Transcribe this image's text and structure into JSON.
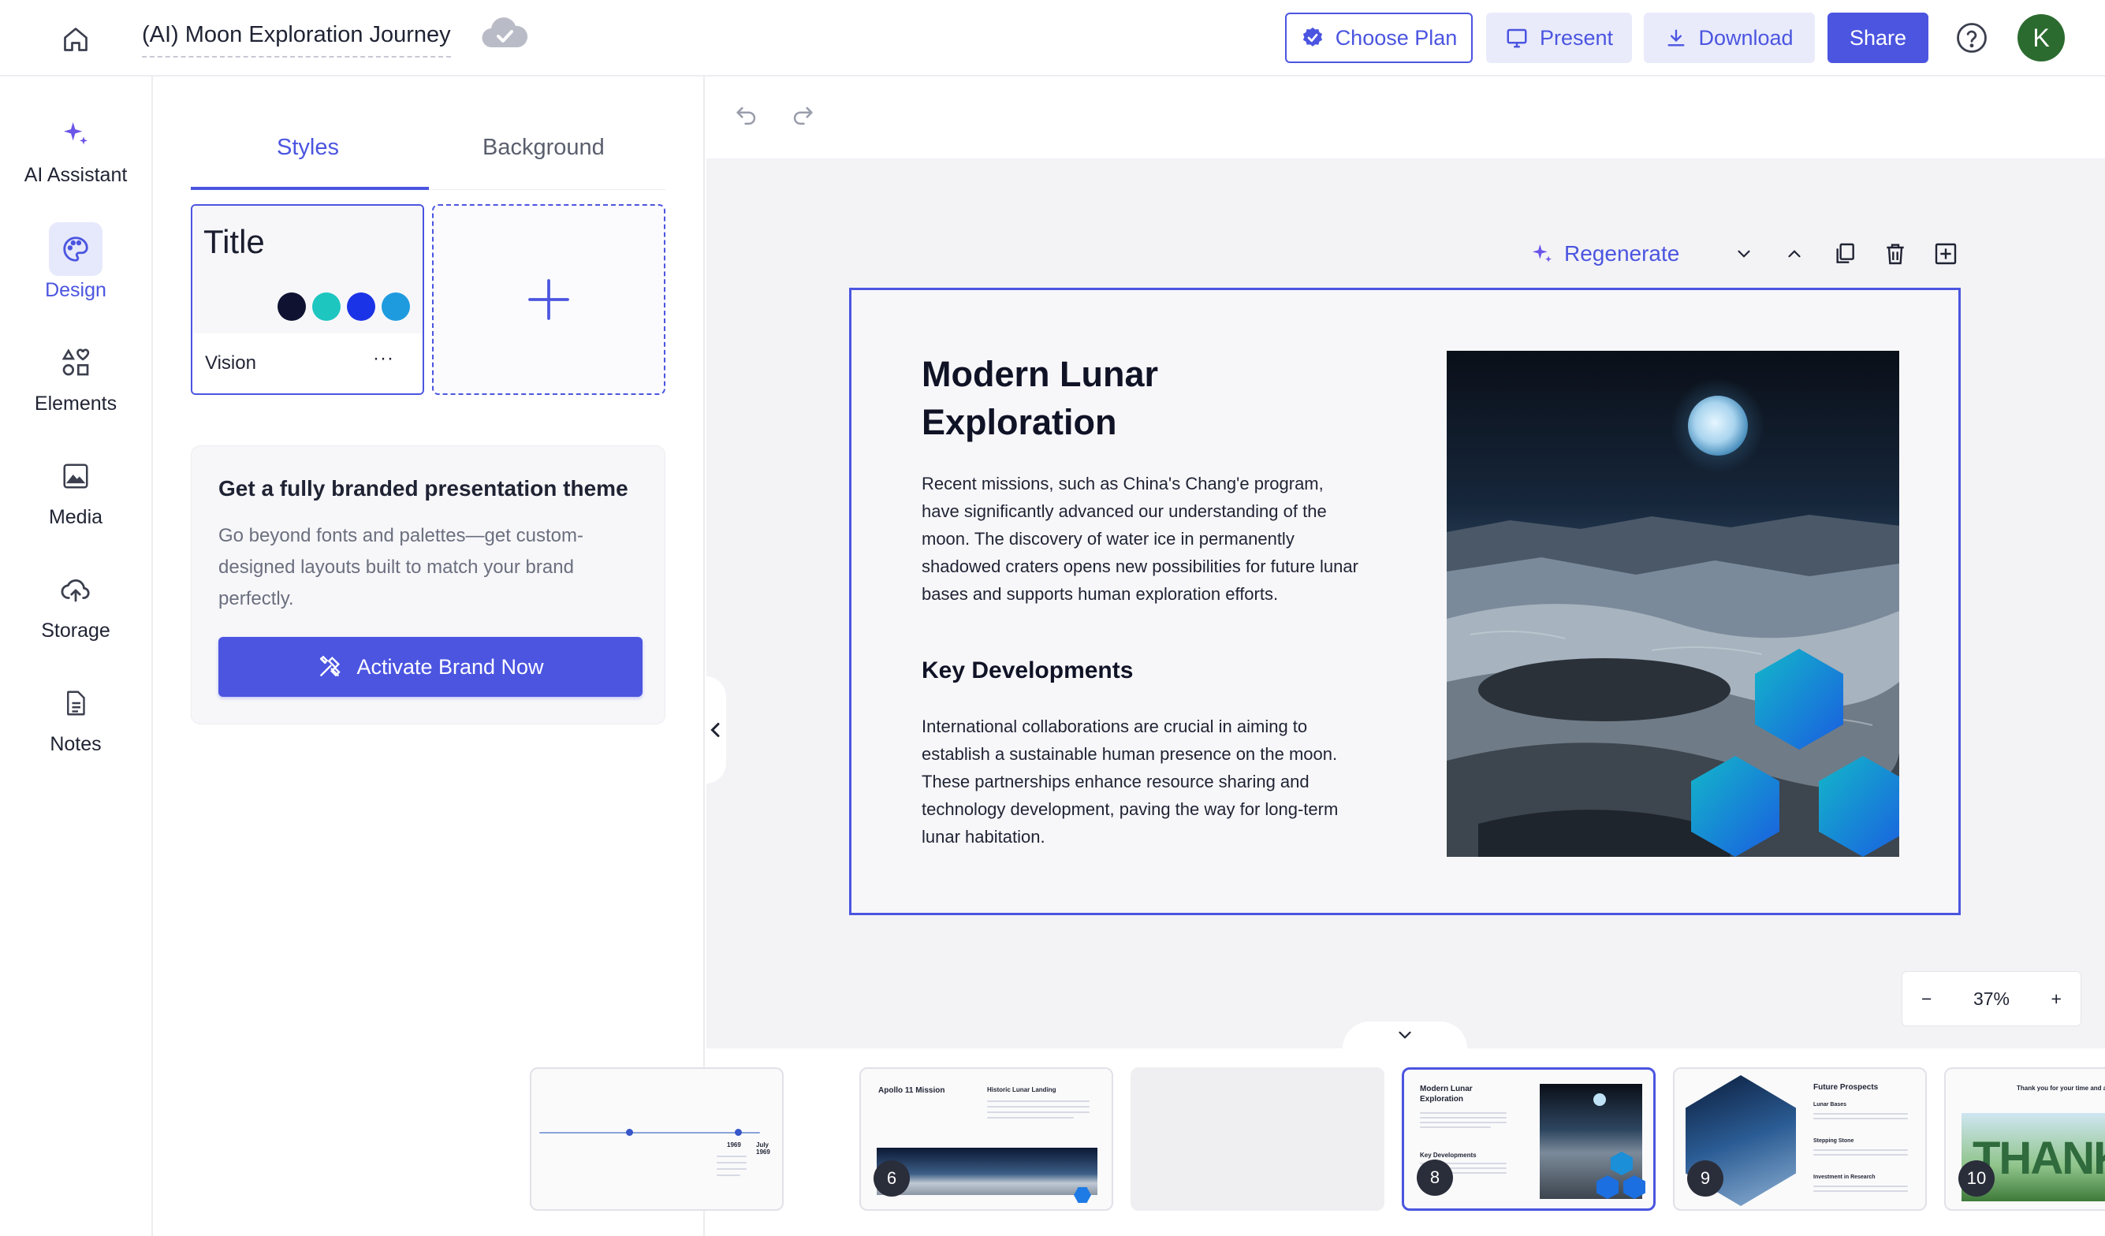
{
  "header": {
    "doc_title": "(AI) Moon Exploration Journey",
    "choose_plan": "Choose Plan",
    "present": "Present",
    "download": "Download",
    "share": "Share",
    "avatar_initial": "K"
  },
  "rail": {
    "items": [
      {
        "label": "AI Assistant",
        "icon": "sparkle-icon"
      },
      {
        "label": "Design",
        "icon": "palette-icon",
        "active": true
      },
      {
        "label": "Elements",
        "icon": "shapes-icon"
      },
      {
        "label": "Media",
        "icon": "image-icon"
      },
      {
        "label": "Storage",
        "icon": "cloud-upload-icon"
      },
      {
        "label": "Notes",
        "icon": "notes-icon"
      }
    ]
  },
  "panel": {
    "tabs": [
      "Styles",
      "Background"
    ],
    "style_card": {
      "preview_title": "Title",
      "name": "Vision",
      "more": "···",
      "colors": [
        "#0f1230",
        "#1ec6c0",
        "#1b33e6",
        "#1e9bdf"
      ]
    },
    "brand": {
      "heading": "Get a fully branded presentation theme",
      "description": "Go beyond fonts and palettes—get custom-designed layouts built to match your brand perfectly.",
      "button": "Activate Brand Now"
    }
  },
  "slide_toolbar": {
    "regenerate": "Regenerate"
  },
  "slide": {
    "title": "Modern Lunar Exploration",
    "paragraph1": "Recent missions, such as China's Chang'e program, have significantly advanced our understanding of the moon. The discovery of water ice in permanently shadowed craters opens new possibilities for future lunar bases and supports human exploration efforts.",
    "subheading": "Key Developments",
    "paragraph2": "International collaborations are crucial in aiming to establish a sustainable human presence on the moon. These partnerships enhance resource sharing and technology development, paving the way for long-term lunar habitation."
  },
  "zoom": {
    "level": "37%",
    "minus": "−",
    "plus": "+"
  },
  "filmstrip": {
    "thumbs": [
      {
        "number": "",
        "title": "",
        "labels": [
          "1969",
          "July 1969"
        ]
      },
      {
        "number": "6",
        "title": "Apollo 11 Mission",
        "subtitle": "Historic Lunar Landing"
      },
      {
        "number": "",
        "title": ""
      },
      {
        "number": "8",
        "title": "Modern Lunar Exploration",
        "subtitle": "Key Developments",
        "active": true
      },
      {
        "number": "9",
        "title": "Future Prospects",
        "labels": [
          "Lunar Bases",
          "Stepping Stone",
          "Investment in Research"
        ]
      },
      {
        "number": "10",
        "title": "Thank you for your time and at",
        "big_text": "THANK"
      }
    ]
  }
}
